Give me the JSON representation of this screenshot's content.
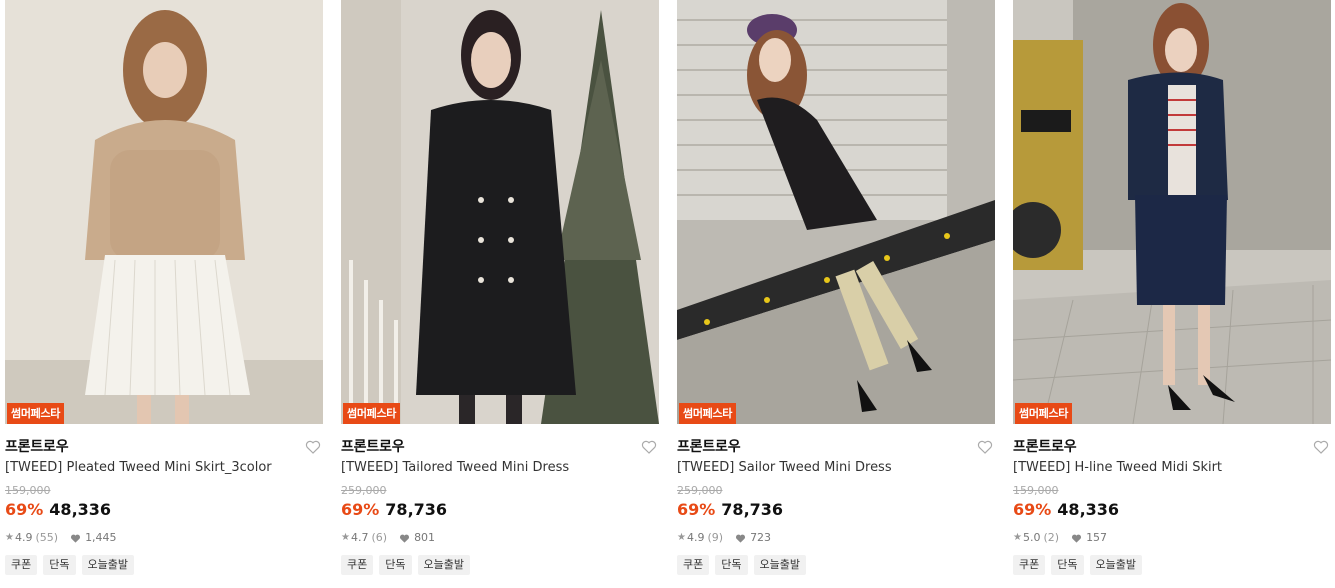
{
  "products": [
    {
      "badge": "썸머페스타",
      "brand": "프론트로우",
      "title": "[TWEED] Pleated Tweed Mini Skirt_3color",
      "original_price": "159,000",
      "discount": "69%",
      "price": "48,336",
      "rating": "4.9",
      "reviews": "(55)",
      "likes": "1,445",
      "tags": [
        "쿠폰",
        "단독",
        "오늘출발"
      ]
    },
    {
      "badge": "썸머페스타",
      "brand": "프론트로우",
      "title": "[TWEED] Tailored Tweed Mini Dress",
      "original_price": "259,000",
      "discount": "69%",
      "price": "78,736",
      "rating": "4.7",
      "reviews": "(6)",
      "likes": "801",
      "tags": [
        "쿠폰",
        "단독",
        "오늘출발"
      ]
    },
    {
      "badge": "썸머페스타",
      "brand": "프론트로우",
      "title": "[TWEED] Sailor Tweed Mini Dress",
      "original_price": "259,000",
      "discount": "69%",
      "price": "78,736",
      "rating": "4.9",
      "reviews": "(9)",
      "likes": "723",
      "tags": [
        "쿠폰",
        "단독",
        "오늘출발"
      ]
    },
    {
      "badge": "썸머페스타",
      "brand": "프론트로우",
      "title": "[TWEED] H-line Tweed Midi Skirt",
      "original_price": "159,000",
      "discount": "69%",
      "price": "48,336",
      "rating": "5.0",
      "reviews": "(2)",
      "likes": "157",
      "tags": [
        "쿠폰",
        "단독",
        "오늘출발"
      ]
    }
  ],
  "colors": {
    "accent": "#e84a16",
    "badge_bg": "#e84a16",
    "tag_bg": "#f1f1f1"
  },
  "icons": {
    "wishlist": "heart-outline-icon",
    "rating": "star-icon",
    "likes": "heart-filled-icon"
  }
}
